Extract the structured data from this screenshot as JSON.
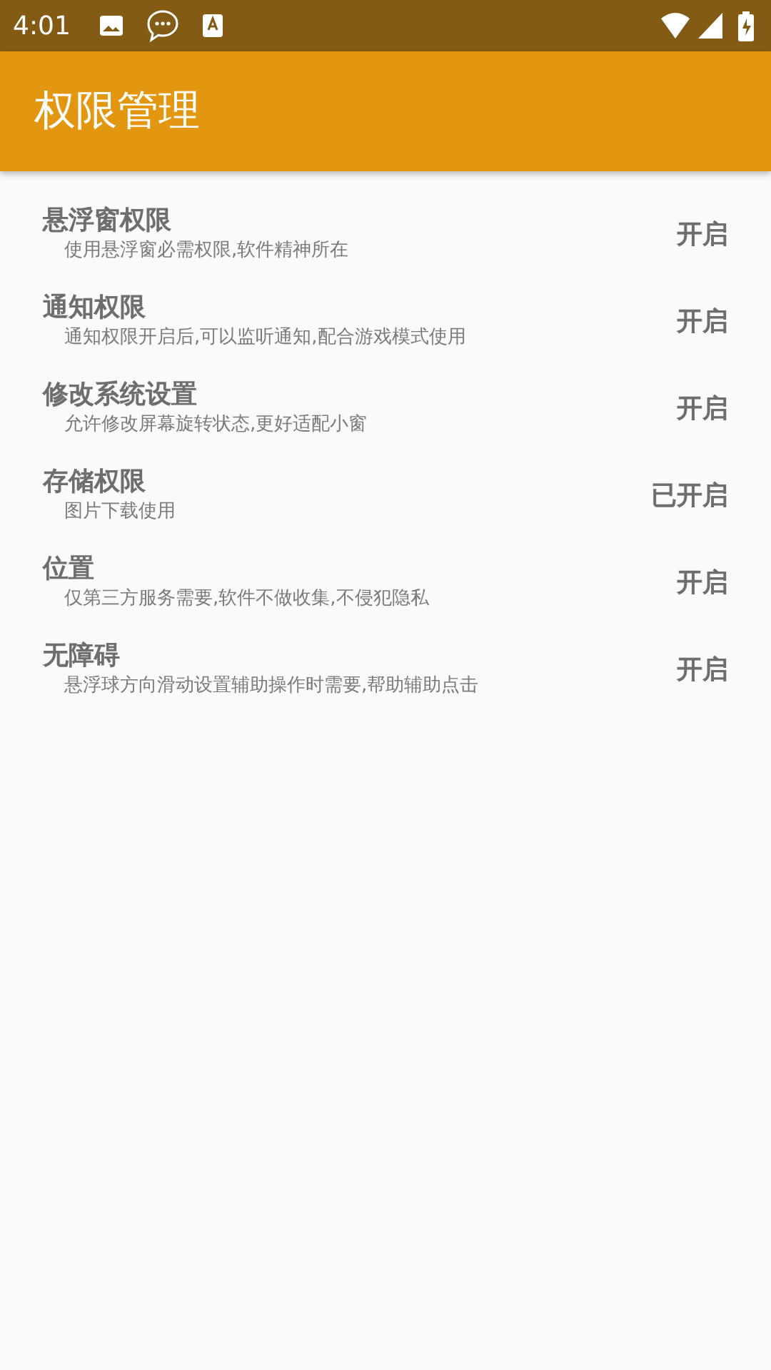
{
  "status_bar": {
    "time": "4:01"
  },
  "app_bar": {
    "title": "权限管理"
  },
  "permissions": [
    {
      "title": "悬浮窗权限",
      "description": "使用悬浮窗必需权限,软件精神所在",
      "action": "开启"
    },
    {
      "title": "通知权限",
      "description": "通知权限开启后,可以监听通知,配合游戏模式使用",
      "action": "开启"
    },
    {
      "title": "修改系统设置",
      "description": "允许修改屏幕旋转状态,更好适配小窗",
      "action": "开启"
    },
    {
      "title": "存储权限",
      "description": "图片下载使用",
      "action": "已开启"
    },
    {
      "title": "位置",
      "description": "仅第三方服务需要,软件不做收集,不侵犯隐私",
      "action": "开启"
    },
    {
      "title": "无障碍",
      "description": "悬浮球方向滑动设置辅助操作时需要,帮助辅助点击",
      "action": "开启"
    }
  ]
}
